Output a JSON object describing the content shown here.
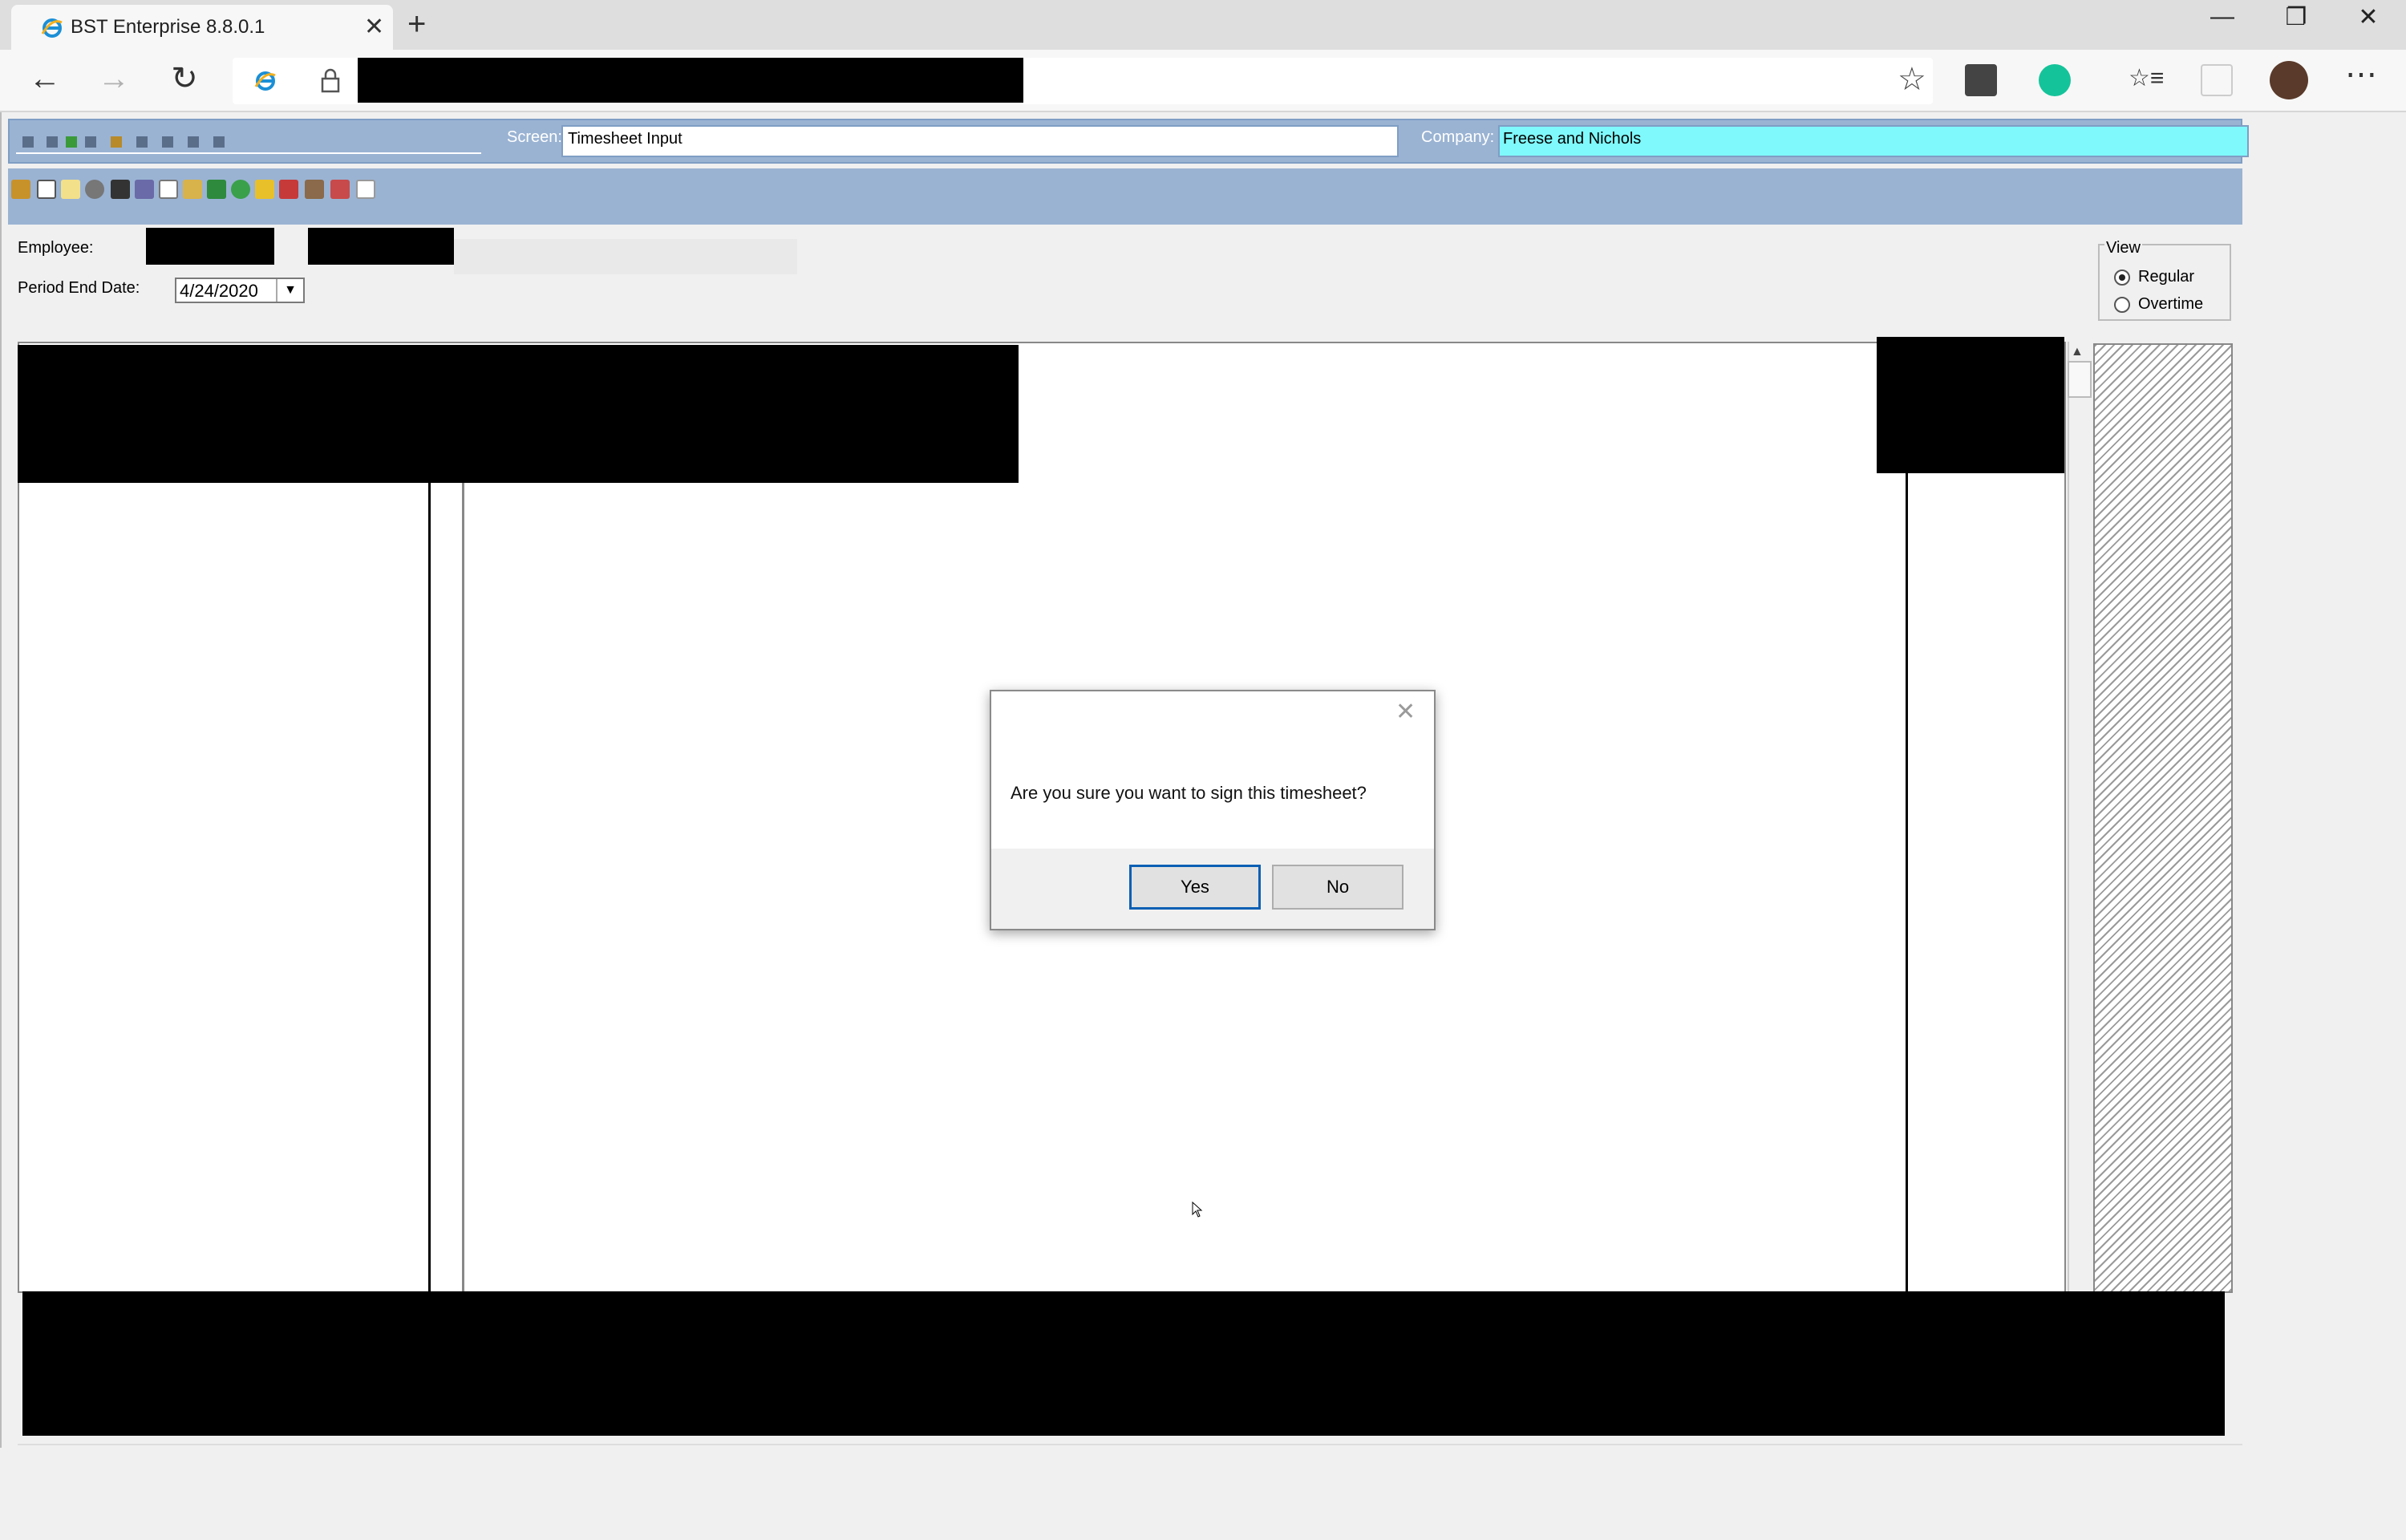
{
  "browser": {
    "tab_title": "BST Enterprise 8.8.0.1",
    "tab_close": "✕",
    "new_tab": "+",
    "window": {
      "minimize": "—",
      "maximize": "❐",
      "close": "✕"
    },
    "nav": {
      "back": "←",
      "forward": "→",
      "refresh": "↻"
    },
    "more": "⋯",
    "favorite": "☆",
    "favorites_bar": "☆≡"
  },
  "app": {
    "screen_label": "Screen:",
    "screen_value": "Timesheet Input",
    "company_label": "Company:",
    "company_value": "Freese and Nichols",
    "employee_label": "Employee:",
    "period_label": "Period End Date:",
    "period_value": "4/24/2020",
    "dropdown_arrow": "▼",
    "view": {
      "title": "View",
      "options": [
        {
          "label": "Regular",
          "selected": true
        },
        {
          "label": "Overtime",
          "selected": false
        }
      ]
    },
    "scroll_up": "▲"
  },
  "dialog": {
    "close": "✕",
    "message": "Are you sure you want to sign this timesheet?",
    "yes": "Yes",
    "no": "No"
  },
  "colors": {
    "header_blue": "#9ab3d3",
    "company_cyan": "#7ff9fb",
    "redaction": "#000000"
  }
}
